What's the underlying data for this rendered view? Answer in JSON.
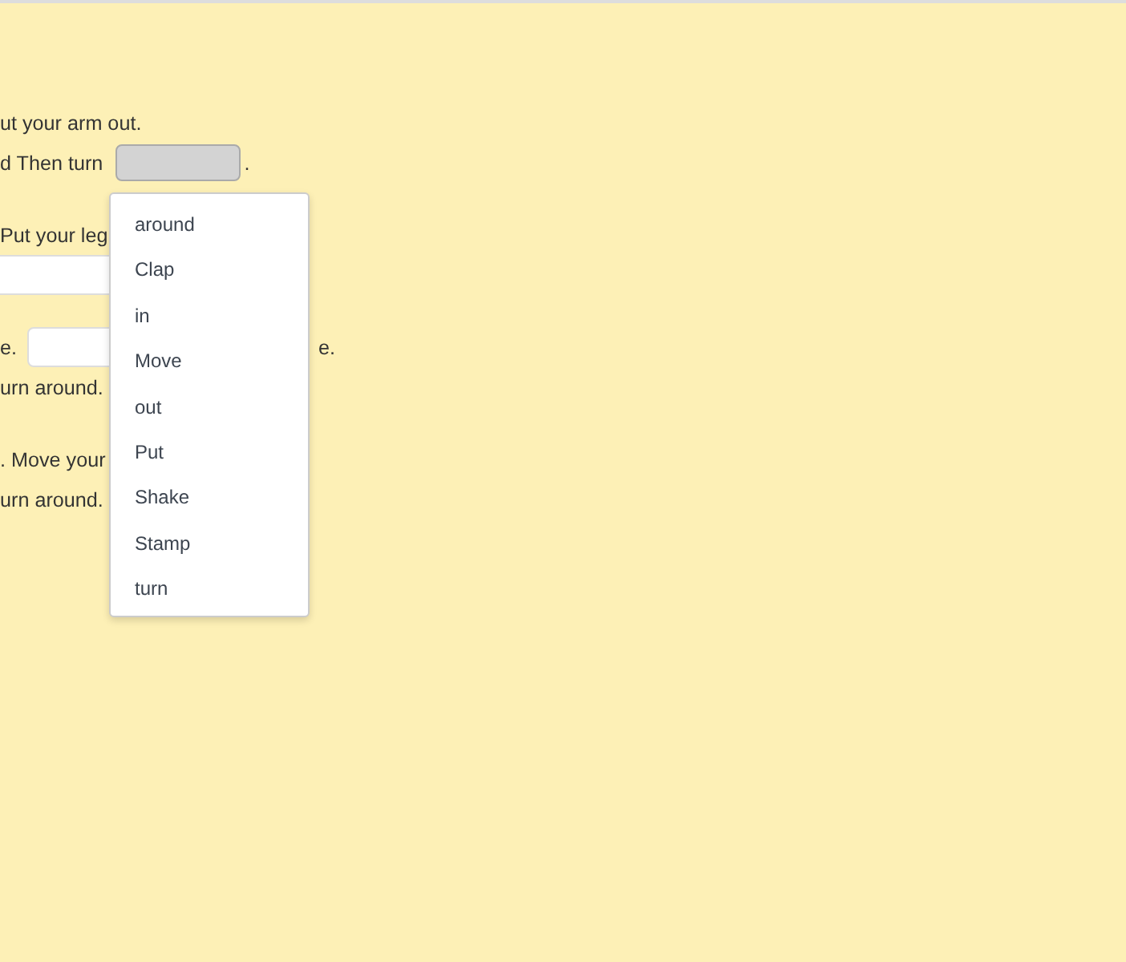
{
  "paragraphs": [
    [
      [
        {
          "kind": "text",
          "text": "ut your arm out."
        }
      ],
      [
        {
          "kind": "text",
          "text": "d Then turn"
        },
        {
          "kind": "blank",
          "selected": true
        },
        {
          "kind": "text",
          "text": "."
        }
      ]
    ],
    [
      [
        {
          "kind": "text",
          "text": "Put your leg"
        }
      ],
      [
        {
          "kind": "blank",
          "selected": false
        }
      ]
    ],
    [
      [
        {
          "kind": "text",
          "text": "e."
        },
        {
          "kind": "blank",
          "selected": false
        },
        {
          "kind": "text",
          "text": "e."
        }
      ],
      [
        {
          "kind": "text",
          "text": "urn around."
        }
      ]
    ],
    [
      [
        {
          "kind": "text",
          "text": ". Move your"
        }
      ],
      [
        {
          "kind": "text",
          "text": "urn around."
        }
      ]
    ]
  ],
  "dropdown": {
    "options": [
      "around",
      "Clap",
      "in",
      "Move",
      "out",
      "Put",
      "Shake",
      "Stamp",
      "turn"
    ]
  }
}
